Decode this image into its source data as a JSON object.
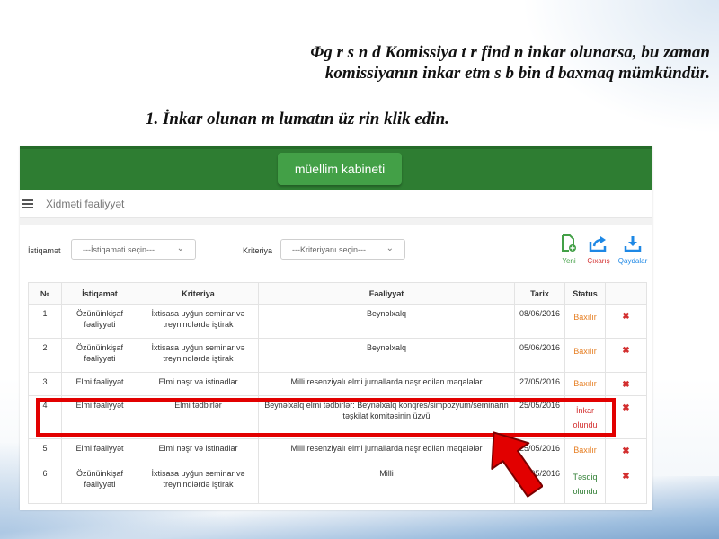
{
  "slide": {
    "line1": "Φg r s n d Komissiya t r find n inkar olunarsa, bu zaman",
    "line2": "komissiyanın inkar etm s b bin d baxmaq mümkündür.",
    "line3": "1. İnkar olunan m lumatın üz rin klik edin."
  },
  "app": {
    "cabinet_button": "müellim kabineti",
    "nav_title": "Xidməti fəaliyyət",
    "filters": {
      "istiqamet_label": "İstiqamət",
      "istiqamet_placeholder": "---İstiqaməti seçin---",
      "kriteriya_label": "Kriteriya",
      "kriteriya_placeholder": "---Kriteriyanı seçin---"
    },
    "tools": {
      "new": "Yeni",
      "export": "Çıxarış",
      "rules": "Qaydalar"
    },
    "colors": {
      "topbar": "#2e7d32",
      "button": "#43a047",
      "highlight": "#e20000",
      "status_rejected": "#d32f2f",
      "status_approved": "#2e7d32",
      "status_pending": "#e67e22"
    },
    "table": {
      "headers": [
        "№",
        "İstiqamət",
        "Kriteriya",
        "Fəaliyyət",
        "Tarix",
        "Status"
      ],
      "rows": [
        {
          "no": "1",
          "istiqamet": "Özünüinkişaf fəaliyyəti",
          "kriteriya": "İxtisasa uyğun seminar və treyninqlərdə iştirak",
          "fealiyyet": "Beynəlxalq",
          "tarix": "08/06/2016",
          "status": "Baxılır"
        },
        {
          "no": "2",
          "istiqamet": "Özünüinkişaf fəaliyyəti",
          "kriteriya": "İxtisasa uyğun seminar və treyninqlərdə iştirak",
          "fealiyyet": "Beynəlxalq",
          "tarix": "05/06/2016",
          "status": "Baxılır"
        },
        {
          "no": "3",
          "istiqamet": "Elmi fəaliyyət",
          "kriteriya": "Elmi nəşr və istinadlar",
          "fealiyyet": "Milli resenziyalı elmi jurnallarda nəşr edilən məqalələr",
          "tarix": "27/05/2016",
          "status": "Baxılır"
        },
        {
          "no": "4",
          "istiqamet": "Elmi fəaliyyət",
          "kriteriya": "Elmi tədbirlər",
          "fealiyyet": "Beynəlxalq elmi tədbirlər: Beynəlxalq konqres/simpozyum/seminarın təşkilat komitəsinin üzvü",
          "tarix": "25/05/2016",
          "status": "İnkar olundu"
        },
        {
          "no": "5",
          "istiqamet": "Elmi fəaliyyət",
          "kriteriya": "Elmi nəşr və istinadlar",
          "fealiyyet": "Milli resenziyalı elmi jurnallarda nəşr edilən məqalələr",
          "tarix": "25/05/2016",
          "status": "Baxılır"
        },
        {
          "no": "6",
          "istiqamet": "Özünüinkişaf fəaliyyəti",
          "kriteriya": "İxtisasa uyğun seminar və treyninqlərdə iştirak",
          "fealiyyet": "Milli",
          "tarix": "16/05/2016",
          "status": "Təsdiq olundu"
        }
      ]
    }
  }
}
